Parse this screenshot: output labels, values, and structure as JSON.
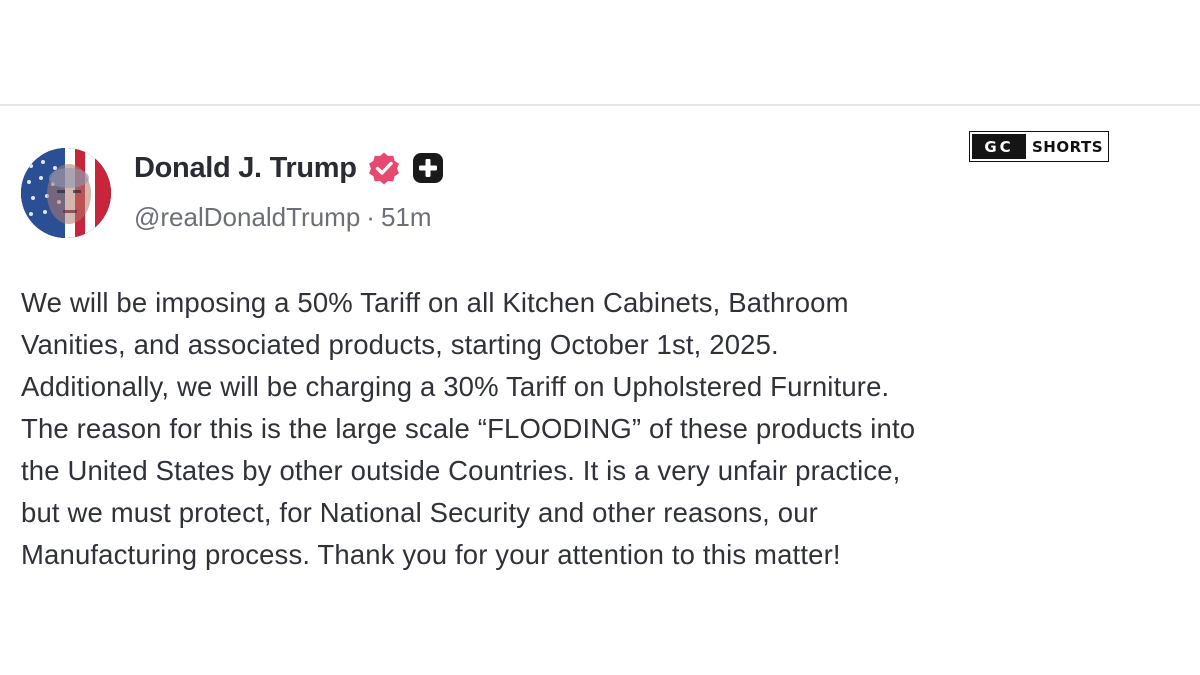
{
  "post": {
    "author": {
      "display_name": "Donald J. Trump",
      "handle": "@realDonaldTrump",
      "time_ago": "51m",
      "separator": "·",
      "verified_icon": "verified-badge-icon",
      "plus_icon": "plus-badge-icon"
    },
    "body_lines": [
      "We will be imposing a 50% Tariff on all Kitchen Cabinets, Bathroom",
      "Vanities, and associated products, starting October 1st, 2025.",
      "Additionally, we will be charging a 30% Tariff on Upholstered Furniture.",
      "The reason for this is the large scale “FLOODING” of these products into",
      "the United States by other outside Countries. It is a very unfair practice,",
      "but we must protect, for National Security and other reasons, our",
      "Manufacturing process. Thank you for your attention to this matter!"
    ]
  },
  "watermark": {
    "left_text": "GC",
    "right_text": "SHORTS"
  },
  "colors": {
    "verified_badge": "#e8496e",
    "plus_badge": "#1a1a1a",
    "name_text": "#2a2c33",
    "meta_text": "#6c6f78"
  }
}
